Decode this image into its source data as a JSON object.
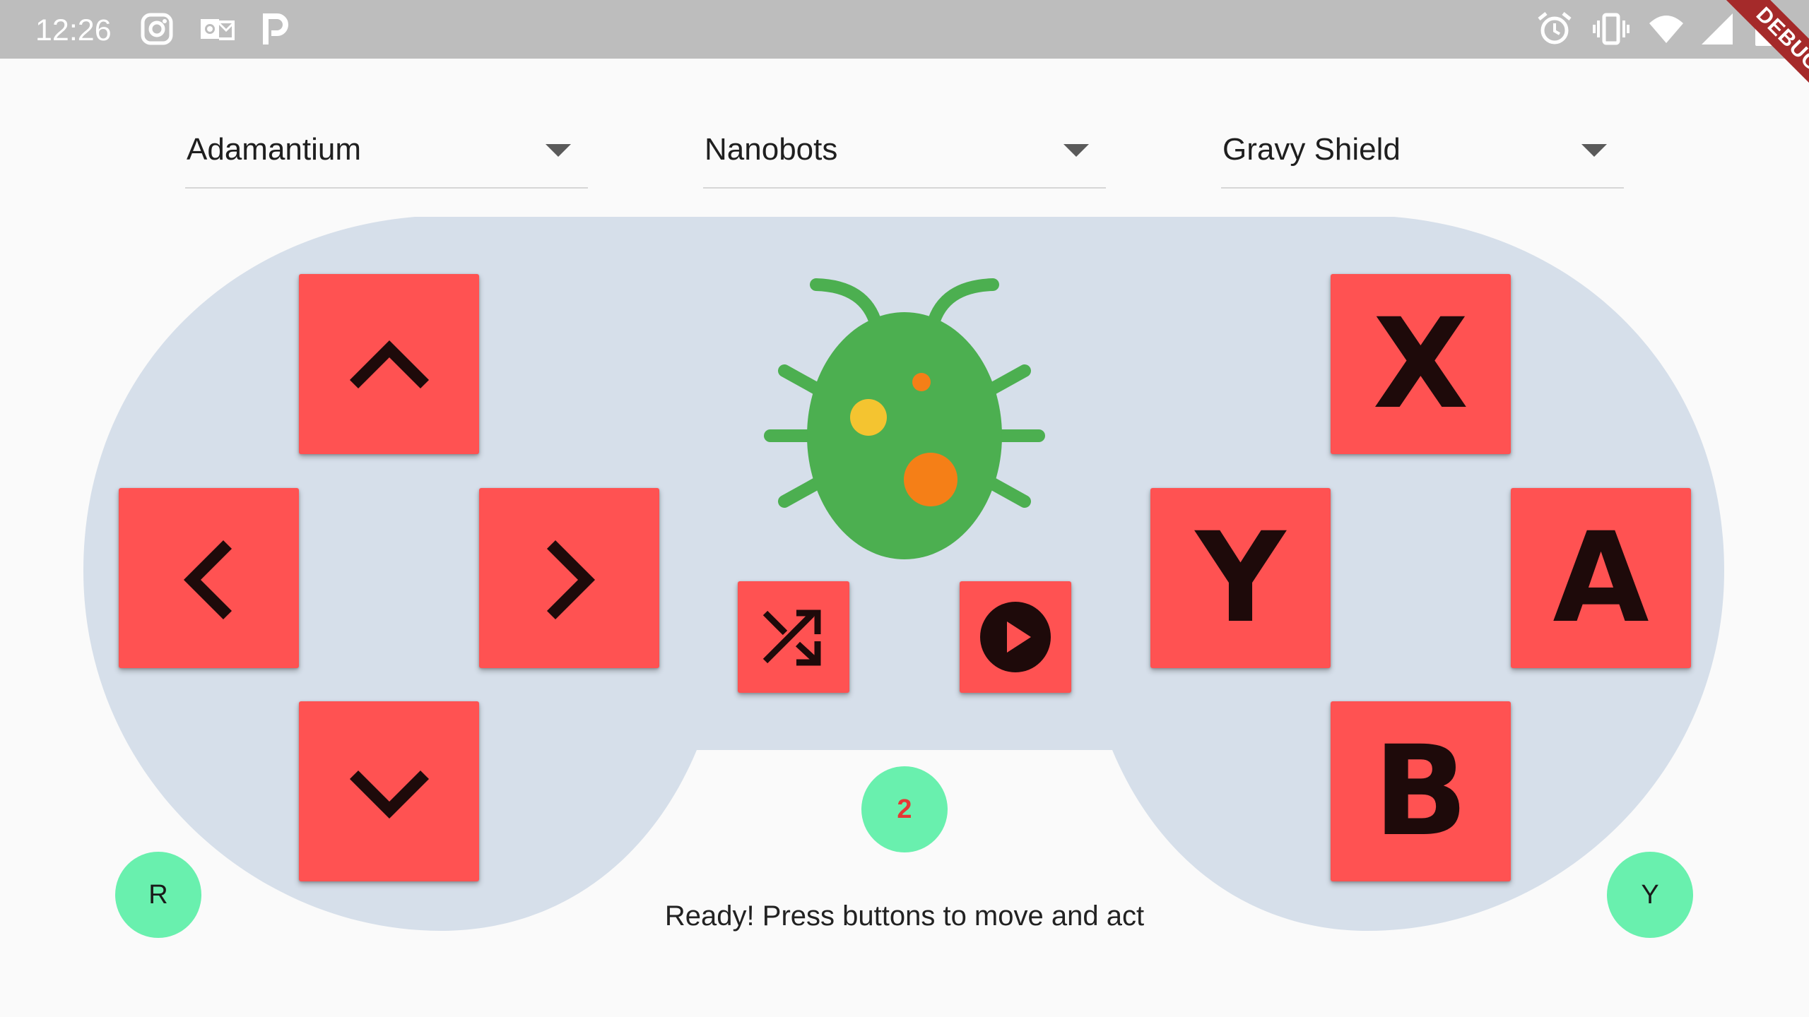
{
  "status_bar": {
    "time": "12:26",
    "left_icons": [
      "instagram-icon",
      "outlook-icon",
      "parking-app-icon"
    ],
    "right_icons": [
      "alarm-icon",
      "vibrate-icon",
      "wifi-icon",
      "signal-icon",
      "battery-icon"
    ]
  },
  "debug_banner": "DEBUG",
  "dropdowns": [
    {
      "value": "Adamantium"
    },
    {
      "value": "Nanobots"
    },
    {
      "value": "Gravy Shield"
    }
  ],
  "dpad": {
    "up_icon": "chevron-up-icon",
    "left_icon": "chevron-left-icon",
    "right_icon": "chevron-right-icon",
    "down_icon": "chevron-down-icon"
  },
  "face_buttons": {
    "x": "X",
    "y": "Y",
    "a": "A",
    "b": "B"
  },
  "center": {
    "character_icon": "bug-icon",
    "shuffle_icon": "shuffle-icon",
    "play_icon": "play-circle-icon",
    "counter": "2"
  },
  "corner_buttons": {
    "left": "R",
    "right": "Y"
  },
  "status_message": "Ready! Press buttons to move and act",
  "colors": {
    "button_red": "#ff5252",
    "controller_body": "#d6dfea",
    "accent_green": "#69f0ae",
    "bug_green": "#4caf50"
  }
}
